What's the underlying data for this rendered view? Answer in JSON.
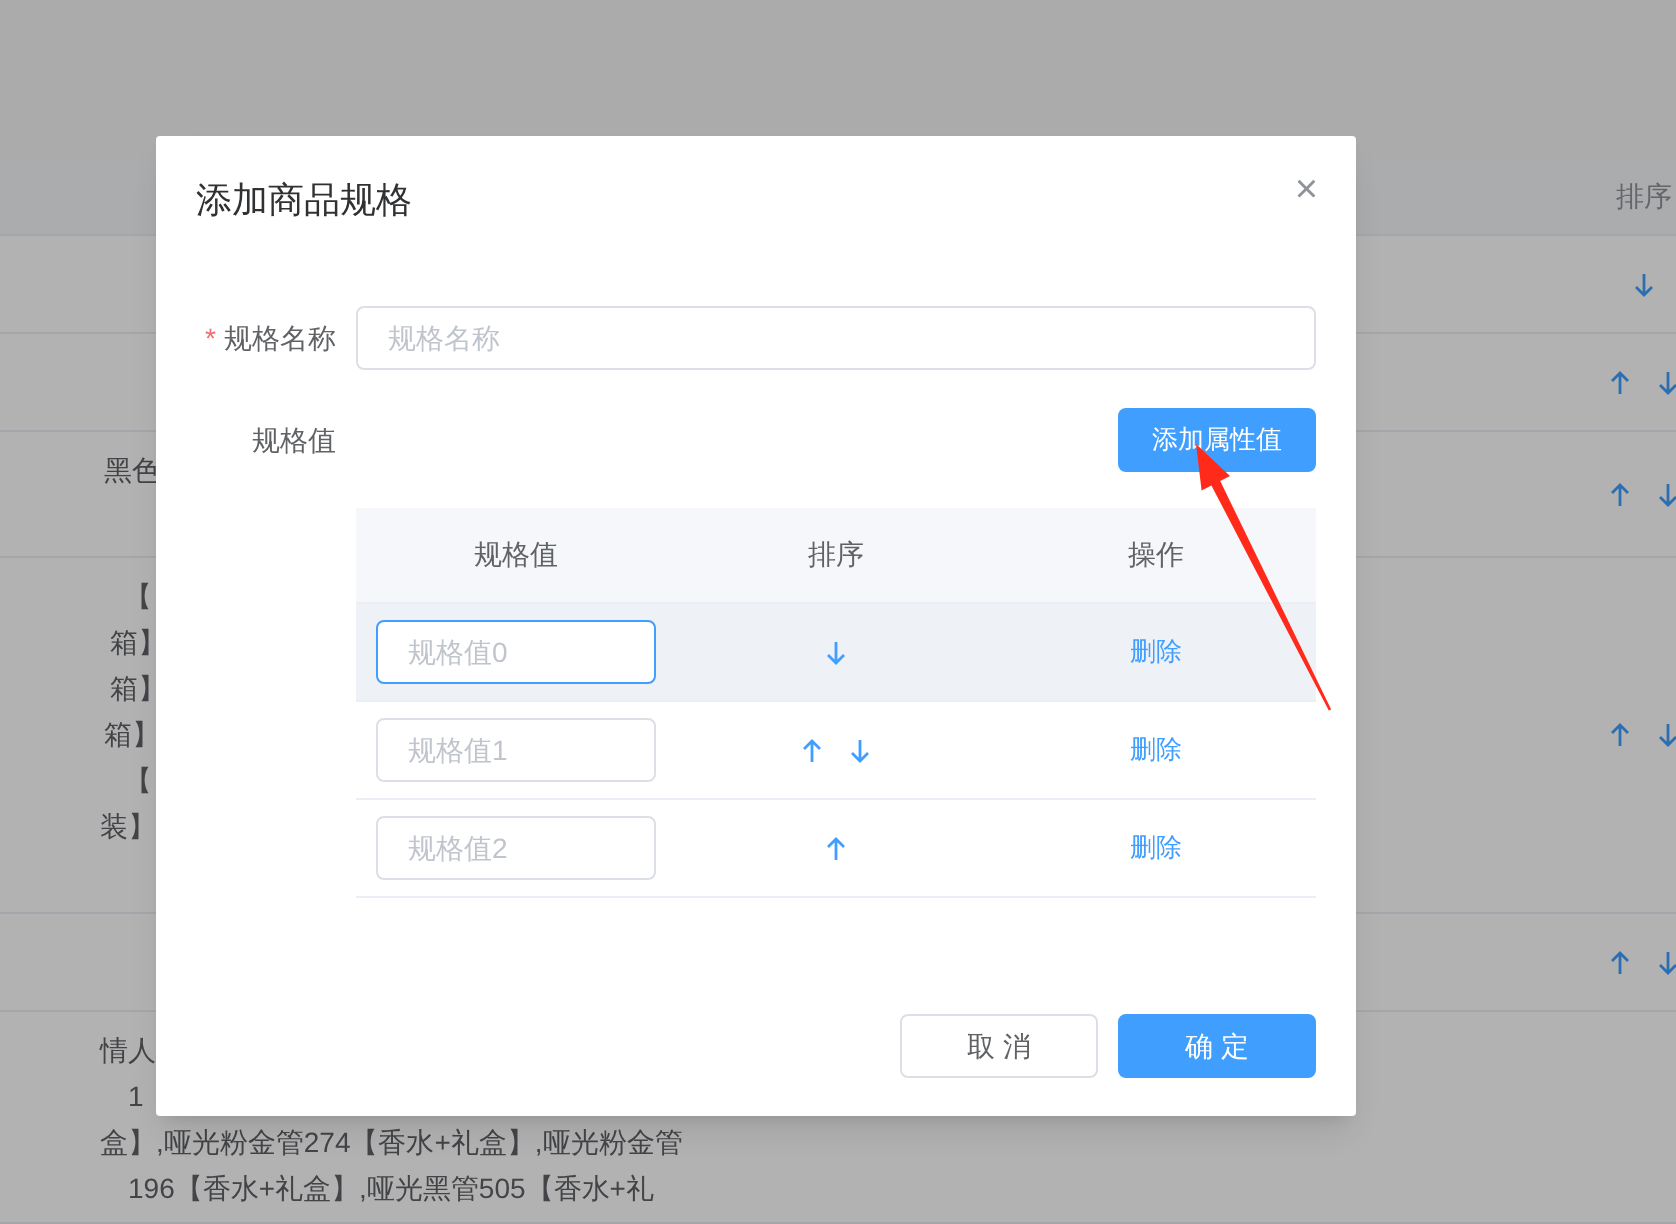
{
  "background_page": {
    "sort_header": "排序",
    "rows": [
      {
        "lines": [],
        "move_up": false,
        "move_down": true
      },
      {
        "lines": [],
        "move_up": true,
        "move_down": true
      },
      {
        "lines": [
          "黑色"
        ],
        "move_up": true,
        "move_down": true
      },
      {
        "lines": [
          "【",
          "箱】",
          "箱】",
          "箱】",
          "【",
          "装】"
        ],
        "move_up": true,
        "move_down": true
      },
      {
        "lines": [],
        "move_up": true,
        "move_down": true
      },
      {
        "lines": [
          "情人",
          "1",
          "盒】,哑光粉金管274【香水+礼盒】,哑光粉金管",
          "196【香水+礼盒】,哑光黑管505【香水+礼"
        ],
        "move_up": false,
        "move_down": false
      }
    ]
  },
  "dialog": {
    "title": "添加商品规格",
    "close": "×",
    "name_field": {
      "label": "规格名称",
      "required": true,
      "required_mark": "*",
      "placeholder": "规格名称"
    },
    "values_label": "规格值",
    "add_button": "添加属性值",
    "table": {
      "columns": [
        "规格值",
        "排序",
        "操作"
      ],
      "rows": [
        {
          "placeholder": "规格值0",
          "focused": true,
          "highlighted": true,
          "move_up": false,
          "move_down": true,
          "action": "删除"
        },
        {
          "placeholder": "规格值1",
          "focused": false,
          "highlighted": false,
          "move_up": true,
          "move_down": true,
          "action": "删除"
        },
        {
          "placeholder": "规格值2",
          "focused": false,
          "highlighted": false,
          "move_up": true,
          "move_down": false,
          "action": "删除"
        }
      ]
    },
    "buttons": [
      {
        "label": "取 消",
        "kind": "secondary"
      },
      {
        "label": "确 定",
        "kind": "primary"
      }
    ]
  },
  "annotation_arrow": true
}
